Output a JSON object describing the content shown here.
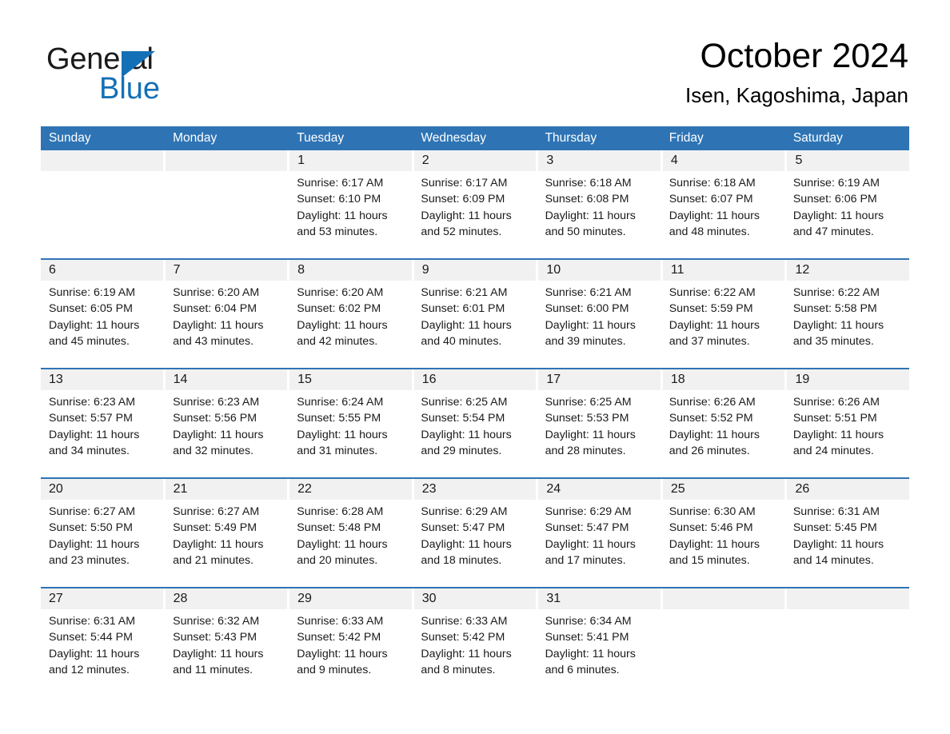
{
  "brand": {
    "name_part1": "General",
    "name_part2": "Blue",
    "triangle_icon": "triangle-icon",
    "accent_color": "#1470b6"
  },
  "header": {
    "title": "October 2024",
    "subtitle": "Isen, Kagoshima, Japan"
  },
  "theme": {
    "header_blue": "#2e74b5",
    "date_band_gray": "#f1f1f1",
    "text_black": "#1a1a1a"
  },
  "weekdays": [
    "Sunday",
    "Monday",
    "Tuesday",
    "Wednesday",
    "Thursday",
    "Friday",
    "Saturday"
  ],
  "weeks": [
    {
      "days": [
        {
          "num": "",
          "lines": []
        },
        {
          "num": "",
          "lines": []
        },
        {
          "num": "1",
          "lines": [
            "Sunrise: 6:17 AM",
            "Sunset: 6:10 PM",
            "Daylight: 11 hours",
            "and 53 minutes."
          ]
        },
        {
          "num": "2",
          "lines": [
            "Sunrise: 6:17 AM",
            "Sunset: 6:09 PM",
            "Daylight: 11 hours",
            "and 52 minutes."
          ]
        },
        {
          "num": "3",
          "lines": [
            "Sunrise: 6:18 AM",
            "Sunset: 6:08 PM",
            "Daylight: 11 hours",
            "and 50 minutes."
          ]
        },
        {
          "num": "4",
          "lines": [
            "Sunrise: 6:18 AM",
            "Sunset: 6:07 PM",
            "Daylight: 11 hours",
            "and 48 minutes."
          ]
        },
        {
          "num": "5",
          "lines": [
            "Sunrise: 6:19 AM",
            "Sunset: 6:06 PM",
            "Daylight: 11 hours",
            "and 47 minutes."
          ]
        }
      ]
    },
    {
      "days": [
        {
          "num": "6",
          "lines": [
            "Sunrise: 6:19 AM",
            "Sunset: 6:05 PM",
            "Daylight: 11 hours",
            "and 45 minutes."
          ]
        },
        {
          "num": "7",
          "lines": [
            "Sunrise: 6:20 AM",
            "Sunset: 6:04 PM",
            "Daylight: 11 hours",
            "and 43 minutes."
          ]
        },
        {
          "num": "8",
          "lines": [
            "Sunrise: 6:20 AM",
            "Sunset: 6:02 PM",
            "Daylight: 11 hours",
            "and 42 minutes."
          ]
        },
        {
          "num": "9",
          "lines": [
            "Sunrise: 6:21 AM",
            "Sunset: 6:01 PM",
            "Daylight: 11 hours",
            "and 40 minutes."
          ]
        },
        {
          "num": "10",
          "lines": [
            "Sunrise: 6:21 AM",
            "Sunset: 6:00 PM",
            "Daylight: 11 hours",
            "and 39 minutes."
          ]
        },
        {
          "num": "11",
          "lines": [
            "Sunrise: 6:22 AM",
            "Sunset: 5:59 PM",
            "Daylight: 11 hours",
            "and 37 minutes."
          ]
        },
        {
          "num": "12",
          "lines": [
            "Sunrise: 6:22 AM",
            "Sunset: 5:58 PM",
            "Daylight: 11 hours",
            "and 35 minutes."
          ]
        }
      ]
    },
    {
      "days": [
        {
          "num": "13",
          "lines": [
            "Sunrise: 6:23 AM",
            "Sunset: 5:57 PM",
            "Daylight: 11 hours",
            "and 34 minutes."
          ]
        },
        {
          "num": "14",
          "lines": [
            "Sunrise: 6:23 AM",
            "Sunset: 5:56 PM",
            "Daylight: 11 hours",
            "and 32 minutes."
          ]
        },
        {
          "num": "15",
          "lines": [
            "Sunrise: 6:24 AM",
            "Sunset: 5:55 PM",
            "Daylight: 11 hours",
            "and 31 minutes."
          ]
        },
        {
          "num": "16",
          "lines": [
            "Sunrise: 6:25 AM",
            "Sunset: 5:54 PM",
            "Daylight: 11 hours",
            "and 29 minutes."
          ]
        },
        {
          "num": "17",
          "lines": [
            "Sunrise: 6:25 AM",
            "Sunset: 5:53 PM",
            "Daylight: 11 hours",
            "and 28 minutes."
          ]
        },
        {
          "num": "18",
          "lines": [
            "Sunrise: 6:26 AM",
            "Sunset: 5:52 PM",
            "Daylight: 11 hours",
            "and 26 minutes."
          ]
        },
        {
          "num": "19",
          "lines": [
            "Sunrise: 6:26 AM",
            "Sunset: 5:51 PM",
            "Daylight: 11 hours",
            "and 24 minutes."
          ]
        }
      ]
    },
    {
      "days": [
        {
          "num": "20",
          "lines": [
            "Sunrise: 6:27 AM",
            "Sunset: 5:50 PM",
            "Daylight: 11 hours",
            "and 23 minutes."
          ]
        },
        {
          "num": "21",
          "lines": [
            "Sunrise: 6:27 AM",
            "Sunset: 5:49 PM",
            "Daylight: 11 hours",
            "and 21 minutes."
          ]
        },
        {
          "num": "22",
          "lines": [
            "Sunrise: 6:28 AM",
            "Sunset: 5:48 PM",
            "Daylight: 11 hours",
            "and 20 minutes."
          ]
        },
        {
          "num": "23",
          "lines": [
            "Sunrise: 6:29 AM",
            "Sunset: 5:47 PM",
            "Daylight: 11 hours",
            "and 18 minutes."
          ]
        },
        {
          "num": "24",
          "lines": [
            "Sunrise: 6:29 AM",
            "Sunset: 5:47 PM",
            "Daylight: 11 hours",
            "and 17 minutes."
          ]
        },
        {
          "num": "25",
          "lines": [
            "Sunrise: 6:30 AM",
            "Sunset: 5:46 PM",
            "Daylight: 11 hours",
            "and 15 minutes."
          ]
        },
        {
          "num": "26",
          "lines": [
            "Sunrise: 6:31 AM",
            "Sunset: 5:45 PM",
            "Daylight: 11 hours",
            "and 14 minutes."
          ]
        }
      ]
    },
    {
      "days": [
        {
          "num": "27",
          "lines": [
            "Sunrise: 6:31 AM",
            "Sunset: 5:44 PM",
            "Daylight: 11 hours",
            "and 12 minutes."
          ]
        },
        {
          "num": "28",
          "lines": [
            "Sunrise: 6:32 AM",
            "Sunset: 5:43 PM",
            "Daylight: 11 hours",
            "and 11 minutes."
          ]
        },
        {
          "num": "29",
          "lines": [
            "Sunrise: 6:33 AM",
            "Sunset: 5:42 PM",
            "Daylight: 11 hours",
            "and 9 minutes."
          ]
        },
        {
          "num": "30",
          "lines": [
            "Sunrise: 6:33 AM",
            "Sunset: 5:42 PM",
            "Daylight: 11 hours",
            "and 8 minutes."
          ]
        },
        {
          "num": "31",
          "lines": [
            "Sunrise: 6:34 AM",
            "Sunset: 5:41 PM",
            "Daylight: 11 hours",
            "and 6 minutes."
          ]
        },
        {
          "num": "",
          "lines": []
        },
        {
          "num": "",
          "lines": []
        }
      ]
    }
  ]
}
